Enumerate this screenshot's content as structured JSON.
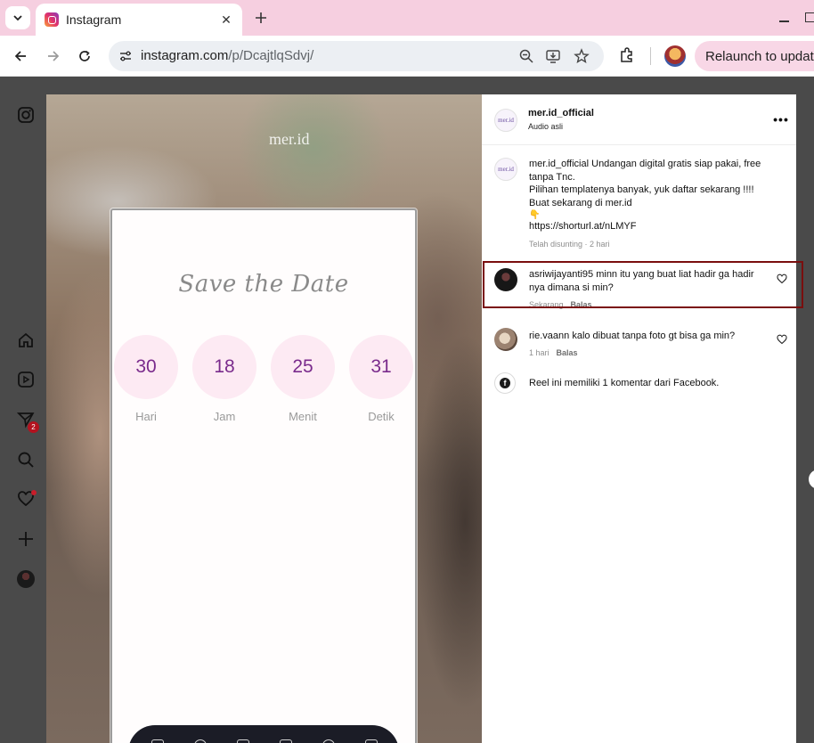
{
  "browser": {
    "tab_title": "Instagram",
    "url_host": "instagram.com",
    "url_path": "/p/DcajtlqSdvj/",
    "relaunch_label": "Relaunch to update"
  },
  "media": {
    "brand": "mer.id",
    "heading": "Save the Date",
    "countdown": [
      {
        "value": "30",
        "label": "Hari"
      },
      {
        "value": "18",
        "label": "Jam"
      },
      {
        "value": "25",
        "label": "Menit"
      },
      {
        "value": "31",
        "label": "Detik"
      }
    ]
  },
  "post": {
    "username": "mer.id_official",
    "audio": "Audio asli",
    "avatar_text": "mer.id",
    "caption_user": "mer.id_official",
    "caption_line1": " Undangan digital gratis siap pakai, free tanpa Tnc.",
    "caption_line2": "Pilihan templatenya banyak, yuk daftar sekarang !!!!",
    "caption_line3": "Buat sekarang di mer.id",
    "caption_link": "https://shorturl.at/nLMYF",
    "caption_meta": "Telah disunting · 2 hari"
  },
  "comments": [
    {
      "user": "asriwijayanti95",
      "text": " minn itu yang buat liat hadir ga hadir nya dimana si min?",
      "time": "Sekarang",
      "reply": "Balas"
    },
    {
      "user": "rie.vaann",
      "text": " kalo dibuat tanpa foto gt bisa ga min?",
      "time": "1 hari",
      "reply": "Balas"
    }
  ],
  "facebook_note": "Reel ini memiliki 1 komentar dari Facebook.",
  "rail": {
    "notification_count": "2"
  },
  "colors": {
    "highlight_border": "#7a0e0e",
    "countdown_bg": "#fdeaf3",
    "countdown_text": "#7a2b8c",
    "tabbar": "#f6cfe0"
  }
}
